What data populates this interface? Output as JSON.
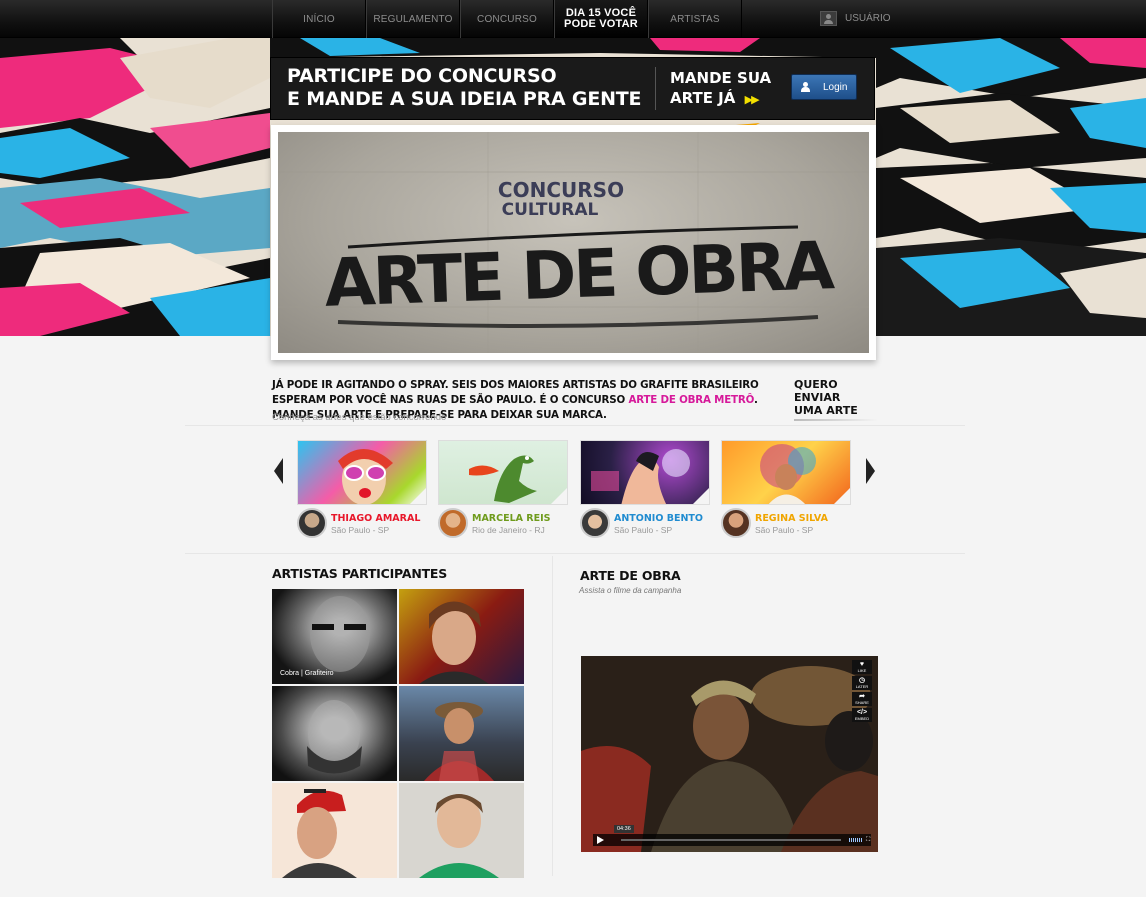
{
  "nav": {
    "items": [
      "INÍCIO",
      "REGULAMENTO",
      "CONCURSO"
    ],
    "vote_line1": "DIA 15 VOCÊ",
    "vote_line2": "PODE VOTAR",
    "artists": "ARTISTAS",
    "user": "USUÁRIO"
  },
  "banner": {
    "line1": "PARTICIPE DO CONCURSO",
    "line2": "E MANDE A SUA IDEIA PRA GENTE",
    "send_line1": "MANDE SUA",
    "send_line2": "ARTE JÁ",
    "arrows": "▶▶",
    "login": "Login"
  },
  "feature": {
    "kicker1": "CONCURSO",
    "kicker2": "CULTURAL",
    "title": "ARTE DE OBRA"
  },
  "intro": {
    "text1": "JÁ PODE IR AGITANDO O SPRAY. SEIS DOS MAIORES ARTISTAS DO GRAFITE BRASILEIRO ESPERAM POR VOCÊ NAS RUAS DE SÃO PAULO. É O CONCURSO ",
    "highlight": "ARTE DE OBRA METRÔ",
    "text2": ". MANDE SUA ARTE E PREPARE-SE PARA DEIXAR SUA MARCA.",
    "send_line1": "QUERO ENVIAR",
    "send_line2": "UMA ARTE",
    "meet": "Conheça as artes que estão concorrendo"
  },
  "entries": [
    {
      "name": "THIAGO AMARAL",
      "location": "São Paulo - SP",
      "color": "#e8172a"
    },
    {
      "name": "MARCELA REIS",
      "location": "Rio de Janeiro - RJ",
      "color": "#6f9b1c"
    },
    {
      "name": "ANTONIO BENTO",
      "location": "São Paulo - SP",
      "color": "#1f8bd0"
    },
    {
      "name": "REGINA SILVA",
      "location": "São Paulo - SP",
      "color": "#f0a500"
    }
  ],
  "artists_section": {
    "title": "ARTISTAS PARTICIPANTES",
    "caption": "Cobra | Grafiteiro"
  },
  "video_section": {
    "title": "ARTE DE OBRA",
    "subtitle": "Assista o filme da campanha",
    "time": "04:36",
    "tools": [
      {
        "glyph": "♥",
        "label": "LIKE"
      },
      {
        "glyph": "◷",
        "label": "LATER"
      },
      {
        "glyph": "➦",
        "label": "SHARE"
      },
      {
        "glyph": "</>",
        "label": "EMBED"
      }
    ],
    "fullscreen_glyph": "⛶"
  }
}
